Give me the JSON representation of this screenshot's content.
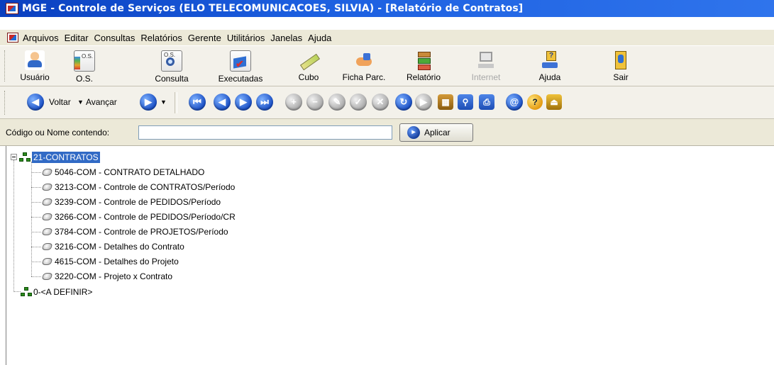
{
  "window": {
    "title": "MGE - Controle de Serviços (ELO TELECOMUNICACOES, SILVIA) - [Relatório de Contratos]"
  },
  "menu": [
    "Arquivos",
    "Editar",
    "Consultas",
    "Relatórios",
    "Gerente",
    "Utilitários",
    "Janelas",
    "Ajuda"
  ],
  "toolbar": [
    {
      "label": "Usuário",
      "icon": "users-icon",
      "enabled": true
    },
    {
      "label": "O.S.",
      "icon": "os-document-icon",
      "enabled": true
    },
    {
      "label": "Consulta",
      "icon": "consulta-magnifier-icon",
      "enabled": true
    },
    {
      "label": "Executadas",
      "icon": "executed-checklist-icon",
      "enabled": true
    },
    {
      "label": "Cubo",
      "icon": "cube-ruler-icon",
      "enabled": true
    },
    {
      "label": "Ficha Parc.",
      "icon": "handshake-icon",
      "enabled": true
    },
    {
      "label": "Relatório",
      "icon": "report-tree-icon",
      "enabled": true
    },
    {
      "label": "Internet",
      "icon": "internet-computer-icon",
      "enabled": false
    },
    {
      "label": "Ajuda",
      "icon": "help-network-icon",
      "enabled": true
    },
    {
      "label": "Sair",
      "icon": "exit-door-icon",
      "enabled": true
    }
  ],
  "nav": {
    "back_label": "Voltar",
    "forward_label": "Avançar"
  },
  "filter": {
    "label": "Código ou Nome contendo:",
    "value": "",
    "apply_label": "Aplicar"
  },
  "tree": {
    "root": {
      "label": "21-CONTRATOS",
      "selected": true,
      "expanded": true,
      "children": [
        "5046-COM - CONTRATO DETALHADO",
        "3213-COM - Controle de CONTRATOS/Período",
        "3239-COM - Controle de PEDIDOS/Período",
        "3266-COM - Controle de PEDIDOS/Período/CR",
        "3784-COM - Controle de PROJETOS/Período",
        "3216-COM - Detalhes do Contrato",
        "4615-COM - Detalhes do Projeto",
        "3220-COM - Projeto x Contrato"
      ]
    },
    "second": {
      "label": "0-<A DEFINIR>"
    }
  }
}
